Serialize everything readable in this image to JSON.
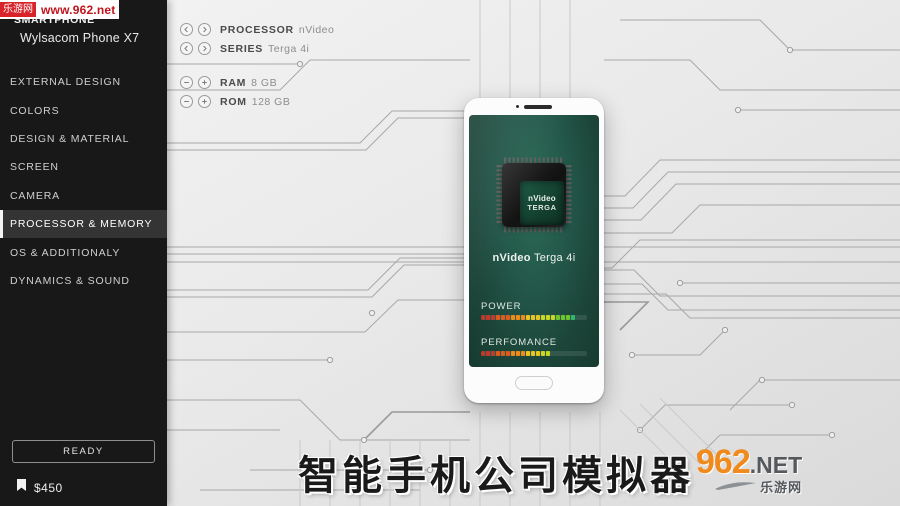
{
  "watermarks": {
    "top_badge": "乐游网",
    "top_url": "www.962.net",
    "bottom_title": "智能手机公司模拟器",
    "logo_number": "962",
    "logo_net": ".NET",
    "logo_cn": "乐游网"
  },
  "sidebar": {
    "kicker": "SMARTPHONE",
    "device_name": "Wylsacom Phone X7",
    "items": [
      {
        "label": "EXTERNAL DESIGN",
        "active": false
      },
      {
        "label": "COLORS",
        "active": false
      },
      {
        "label": "DESIGN & MATERIAL",
        "active": false
      },
      {
        "label": "SCREEN",
        "active": false
      },
      {
        "label": "CAMERA",
        "active": false
      },
      {
        "label": "PROCESSOR & MEMORY",
        "active": true
      },
      {
        "label": "OS & ADDITIONALY",
        "active": false
      },
      {
        "label": "DYNAMICS & SOUND",
        "active": false
      }
    ],
    "ready_label": "READY",
    "price": "$450",
    "price_icon": "price-tag-icon"
  },
  "specs": [
    {
      "label": "PROCESSOR",
      "value": "nVideo",
      "ctrl_left": "chevron-left-icon",
      "ctrl_right": "chevron-right-icon",
      "group": 0
    },
    {
      "label": "SERIES",
      "value": "Terga 4i",
      "ctrl_left": "chevron-left-icon",
      "ctrl_right": "chevron-right-icon",
      "group": 0
    },
    {
      "label": "RAM",
      "value": "8 GB",
      "ctrl_left": "minus-icon",
      "ctrl_right": "plus-icon",
      "group": 1
    },
    {
      "label": "ROM",
      "value": "128 GB",
      "ctrl_left": "minus-icon",
      "ctrl_right": "plus-icon",
      "group": 1
    }
  ],
  "phone": {
    "chip_line1": "nVideo",
    "chip_line2": "TERGA",
    "chip_name_brand": "nVideo",
    "chip_name_model": " Terga 4i",
    "meters": [
      {
        "label": "POWER",
        "segments": 19,
        "total": 24
      },
      {
        "label": "PERFOMANCE",
        "segments": 14,
        "total": 24
      }
    ]
  },
  "colors": {
    "sidebar_bg": "#181818",
    "sidebar_active": "#343434",
    "screen_green": "#23584a",
    "accent_orange": "#f08a1d",
    "watermark_red": "#d8232a"
  }
}
